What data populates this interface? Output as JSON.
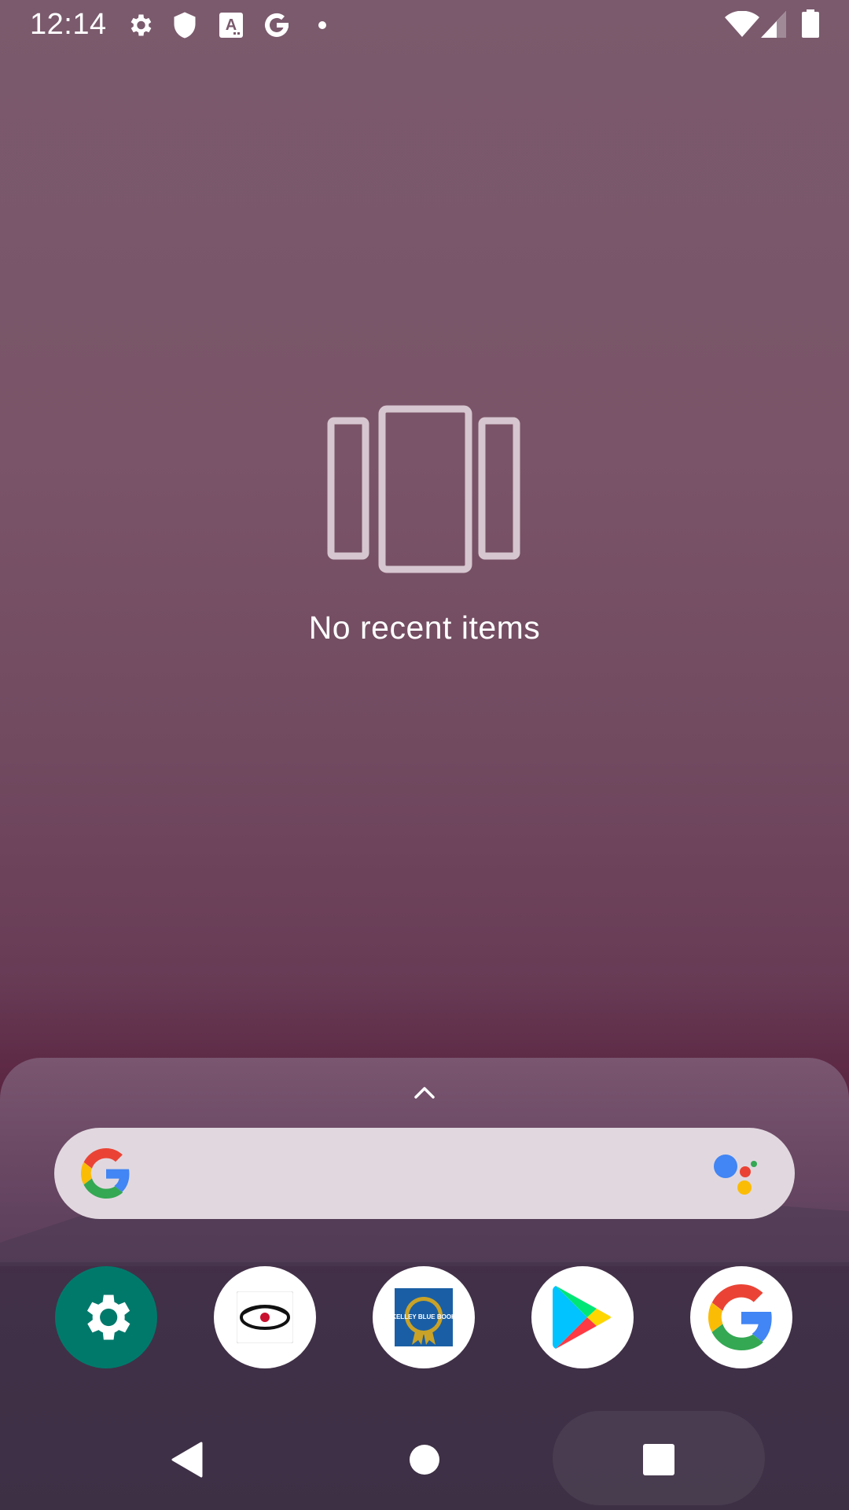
{
  "status_bar": {
    "time": "12:14",
    "left_icons": [
      "settings-icon",
      "shield-icon",
      "text-scan-icon",
      "google-g-icon",
      "notification-dot-icon"
    ],
    "right_icons": [
      "wifi-icon",
      "cellular-signal-icon",
      "battery-icon"
    ]
  },
  "recents": {
    "empty_message": "No recent items"
  },
  "home": {
    "search_bar": {
      "left_icon": "google-g-icon",
      "right_icon": "google-assistant-icon"
    },
    "dock_apps": [
      {
        "icon": "settings-app-icon"
      },
      {
        "icon": "eye-logo-app-icon"
      },
      {
        "icon": "kelley-blue-book-icon",
        "logo_text": "KELLEY BLUE BOOK"
      },
      {
        "icon": "play-store-icon"
      },
      {
        "icon": "google-app-icon"
      }
    ]
  },
  "nav_bar": {
    "buttons": [
      "back-icon",
      "home-icon",
      "recents-icon"
    ]
  },
  "colors": {
    "settings_teal": "#00796b",
    "google_blue": "#4285f4",
    "google_red": "#ea4335",
    "google_yellow": "#fbbc05",
    "google_green": "#34a853",
    "kbb_blue": "#1a5fa5"
  }
}
